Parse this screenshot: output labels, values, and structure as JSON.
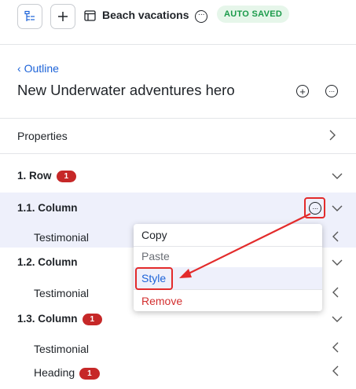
{
  "topbar": {
    "doc_title": "Beach vacations",
    "saved_badge": "AUTO SAVED"
  },
  "header": {
    "back_label": "Outline",
    "page_title": "New Underwater adventures hero"
  },
  "properties": {
    "label": "Properties"
  },
  "tree": {
    "row1": {
      "label": "1. Row",
      "count": "1"
    },
    "col11": {
      "label": "1.1. Column",
      "child": "Testimonial"
    },
    "col12": {
      "label": "1.2. Column",
      "child": "Testimonial"
    },
    "col13": {
      "label": "1.3. Column",
      "count": "1",
      "child1": "Testimonial",
      "child2": "Heading",
      "child2_count": "1"
    }
  },
  "context_menu": {
    "items": [
      "Copy",
      "Paste",
      "Style",
      "Remove"
    ]
  },
  "colors": {
    "accent": "#1d63d8",
    "badge_red": "#c62828",
    "highlight": "#eef0fb",
    "annotation_red": "#e32b2b",
    "saved_green": "#1a9a4a"
  }
}
